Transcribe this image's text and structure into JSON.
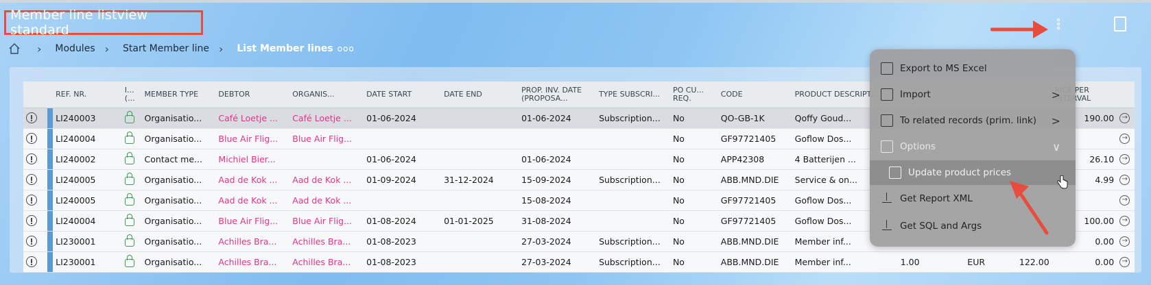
{
  "page_title": "Member line listview standard",
  "breadcrumb": {
    "items": [
      "Modules",
      "Start Member line"
    ],
    "current": "List Member lines",
    "more": "ooo"
  },
  "columns": [
    "REF. NR.",
    "I... (...",
    "MEMBER TYPE",
    "DEBTOR",
    "ORGANIS...",
    "DATE START",
    "DATE END",
    "PROP. INV. DATE (PROPOSA...",
    "TYPE SUBSCRI...",
    "PO CU... REQ.",
    "CODE",
    "PRODUCT DESCRIPT...",
    "",
    "",
    "",
    "RICE PER INTERVAL"
  ],
  "rows": [
    {
      "ref": "LI240003",
      "type": "Organisatio...",
      "debtor": "Café Loetje ...",
      "org": "Café Loetje ...",
      "start": "01-06-2024",
      "end": "",
      "prop": "01-06-2024",
      "sub": "Subscription...",
      "po": "No",
      "code": "QO-GB-1K",
      "desc": "Qoffy Goud...",
      "qty": "",
      "cur": "",
      "price": "",
      "interval": "190.00"
    },
    {
      "ref": "LI240004",
      "type": "Organisatio...",
      "debtor": "Blue Air Flig...",
      "org": "Blue Air Flig...",
      "start": "",
      "end": "",
      "prop": "",
      "sub": "",
      "po": "No",
      "code": "GF97721405",
      "desc": "Goflow Dos...",
      "qty": "",
      "cur": "",
      "price": "",
      "interval": ""
    },
    {
      "ref": "LI240002",
      "type": "Contact me...",
      "debtor": "Michiel Bier...",
      "org": "",
      "start": "01-06-2024",
      "end": "",
      "prop": "01-06-2024",
      "sub": "",
      "po": "No",
      "code": "APP42308",
      "desc": "4 Batterijen ...",
      "qty": "",
      "cur": "",
      "price": "",
      "interval": "26.10"
    },
    {
      "ref": "LI240005",
      "type": "Organisatio...",
      "debtor": "Aad de Kok ...",
      "org": "Aad de Kok ...",
      "start": "01-09-2024",
      "end": "31-12-2024",
      "prop": "15-09-2024",
      "sub": "Subscription...",
      "po": "No",
      "code": "ABB.MND.DIE",
      "desc": "Service & on...",
      "qty": "",
      "cur": "",
      "price": "",
      "interval": "4.99"
    },
    {
      "ref": "LI240005",
      "type": "Organisatio...",
      "debtor": "Aad de Kok ...",
      "org": "Aad de Kok ...",
      "start": "",
      "end": "",
      "prop": "15-08-2024",
      "sub": "",
      "po": "No",
      "code": "GF97721405",
      "desc": "Goflow Dos...",
      "qty": "",
      "cur": "",
      "price": "",
      "interval": ""
    },
    {
      "ref": "LI240004",
      "type": "Organisatio...",
      "debtor": "Blue Air Flig...",
      "org": "Blue Air Flig...",
      "start": "01-08-2024",
      "end": "01-01-2025",
      "prop": "31-08-2024",
      "sub": "",
      "po": "No",
      "code": "GF97721405",
      "desc": "Goflow Dos...",
      "qty": "",
      "cur": "",
      "price": "",
      "interval": "100.00"
    },
    {
      "ref": "LI230001",
      "type": "Organisatio...",
      "debtor": "Achilles Bra...",
      "org": "Achilles Bra...",
      "start": "01-08-2023",
      "end": "",
      "prop": "27-03-2024",
      "sub": "Subscription...",
      "po": "No",
      "code": "ABB.MND.DIE",
      "desc": "Member inf...",
      "qty": "",
      "cur": "",
      "price": "",
      "interval": "0.00"
    },
    {
      "ref": "LI230001",
      "type": "Organisatio...",
      "debtor": "Achilles Bra...",
      "org": "Achilles Bra...",
      "start": "01-08-2023",
      "end": "",
      "prop": "27-03-2024",
      "sub": "Subscription...",
      "po": "No",
      "code": "ABB.MND.DIE",
      "desc": "Member inf...",
      "qty": "1.00",
      "cur": "EUR",
      "price": "122.00",
      "interval": "0.00"
    }
  ],
  "menu": {
    "export": "Export to MS Excel",
    "import": "Import",
    "related": "To related records (prim. link)",
    "options": "Options",
    "update": "Update product prices",
    "report": "Get Report XML",
    "sql": "Get SQL and Args"
  },
  "colors": {
    "accent_pink": "#e0338a",
    "highlight_red": "#e74c3c",
    "row_bar": "#5b9bd5",
    "lock_green": "#3f9a52"
  }
}
